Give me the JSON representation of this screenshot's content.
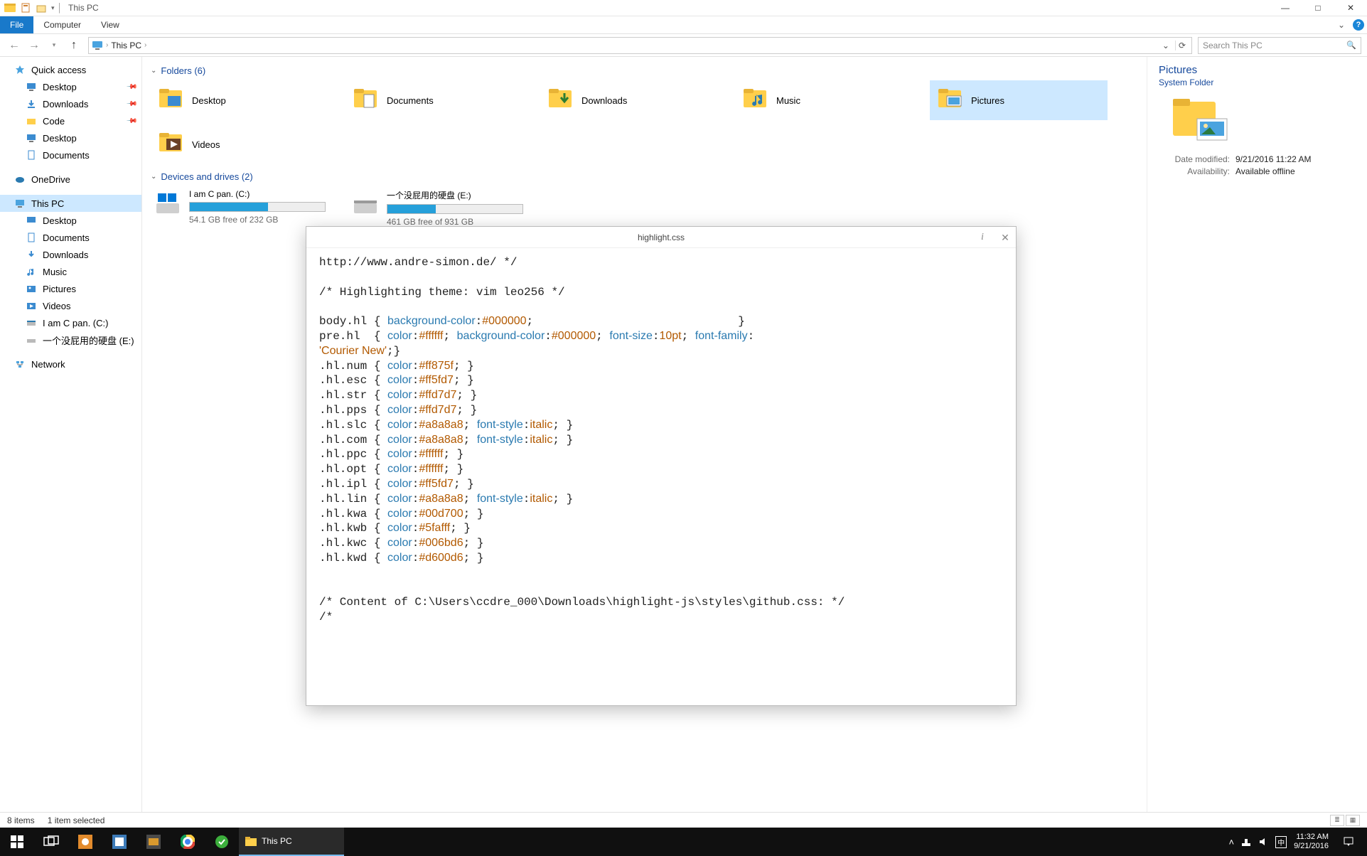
{
  "window": {
    "title": "This PC",
    "qat_dropdown": "▾",
    "win_min": "—",
    "win_max": "□",
    "win_close": "✕"
  },
  "ribbon": {
    "file": "File",
    "computer": "Computer",
    "view": "View",
    "expand": "⌄",
    "help": "?"
  },
  "address": {
    "back": "←",
    "forward": "→",
    "recent_dropdown": "▾",
    "up": "↑",
    "crumb_root": "›",
    "crumb_thispc": "This PC",
    "crumb_chev": "›",
    "dropdown": "⌄",
    "refresh": "⟳",
    "search_placeholder": "Search This PC",
    "search_icon": "🔍"
  },
  "sidebar": {
    "quick_access": "Quick access",
    "quick_items": [
      {
        "label": "Desktop"
      },
      {
        "label": "Downloads"
      },
      {
        "label": "Code"
      },
      {
        "label": "Desktop"
      },
      {
        "label": "Documents"
      }
    ],
    "onedrive": "OneDrive",
    "thispc": "This PC",
    "thispc_items": [
      {
        "label": "Desktop"
      },
      {
        "label": "Documents"
      },
      {
        "label": "Downloads"
      },
      {
        "label": "Music"
      },
      {
        "label": "Pictures"
      },
      {
        "label": "Videos"
      },
      {
        "label": "I am C pan. (C:)"
      },
      {
        "label": "一个没屁用的硬盘 (E:)"
      }
    ],
    "network": "Network"
  },
  "content": {
    "folders_header": "Folders (6)",
    "folders": [
      {
        "label": "Desktop"
      },
      {
        "label": "Documents"
      },
      {
        "label": "Downloads"
      },
      {
        "label": "Music"
      },
      {
        "label": "Pictures",
        "selected": true
      },
      {
        "label": "Videos"
      }
    ],
    "drives_header": "Devices and drives (2)",
    "drives": [
      {
        "label": "I am C pan. (C:)",
        "free_text": "54.1 GB free of 232 GB",
        "fill_pct": 58
      },
      {
        "label": "一个没屁用的硬盘 (E:)",
        "free_text": "461 GB free of 931 GB",
        "fill_pct": 36
      }
    ]
  },
  "details": {
    "title": "Pictures",
    "subtitle": "System Folder",
    "rows": [
      {
        "k": "Date modified:",
        "v": "9/21/2016 11:22 AM"
      },
      {
        "k": "Availability:",
        "v": "Available offline"
      }
    ]
  },
  "preview": {
    "title": "highlight.css",
    "info_icon": "i",
    "close_icon": "✕",
    "lines": [
      {
        "t": "http://www.andre-simon.de/ */"
      },
      {
        "t": ""
      },
      {
        "t": "/* Highlighting theme: vim leo256 */"
      },
      {
        "t": ""
      },
      {
        "sel": "body.hl { ",
        "prop": "background-color",
        "colon": ":",
        "val": "#000000",
        "tail": ";",
        "close_far": "}"
      },
      {
        "sel": "pre.hl  { ",
        "segs": [
          {
            "prop": "color",
            "val": "#ffffff"
          },
          {
            "prop": "background-color",
            "val": "#000000"
          },
          {
            "prop": "font-size",
            "val": "10pt"
          },
          {
            "prop": "font-family",
            "val": null
          }
        ],
        "trailing_colon": ":"
      },
      {
        "sel": "",
        "strv": "'Courier New'",
        "tail2": ";}"
      },
      {
        "sel": ".hl.num { ",
        "prop": "color",
        "val": "#ff875f",
        "tail": "; }"
      },
      {
        "sel": ".hl.esc { ",
        "prop": "color",
        "val": "#ff5fd7",
        "tail": "; }"
      },
      {
        "sel": ".hl.str { ",
        "prop": "color",
        "val": "#ffd7d7",
        "tail": "; }"
      },
      {
        "sel": ".hl.pps { ",
        "prop": "color",
        "val": "#ffd7d7",
        "tail": "; }"
      },
      {
        "sel": ".hl.slc { ",
        "segs": [
          {
            "prop": "color",
            "val": "#a8a8a8"
          },
          {
            "prop": "font-style",
            "val": "italic"
          }
        ],
        "tail": "; }"
      },
      {
        "sel": ".hl.com { ",
        "segs": [
          {
            "prop": "color",
            "val": "#a8a8a8"
          },
          {
            "prop": "font-style",
            "val": "italic"
          }
        ],
        "tail": "; }"
      },
      {
        "sel": ".hl.ppc { ",
        "prop": "color",
        "val": "#ffffff",
        "tail": "; }"
      },
      {
        "sel": ".hl.opt { ",
        "prop": "color",
        "val": "#ffffff",
        "tail": "; }"
      },
      {
        "sel": ".hl.ipl { ",
        "prop": "color",
        "val": "#ff5fd7",
        "tail": "; }"
      },
      {
        "sel": ".hl.lin { ",
        "segs": [
          {
            "prop": "color",
            "val": "#a8a8a8"
          },
          {
            "prop": "font-style",
            "val": "italic"
          }
        ],
        "tail": "; }"
      },
      {
        "sel": ".hl.kwa { ",
        "prop": "color",
        "val": "#00d700",
        "tail": "; }"
      },
      {
        "sel": ".hl.kwb { ",
        "prop": "color",
        "val": "#5fafff",
        "tail": "; }"
      },
      {
        "sel": ".hl.kwc { ",
        "prop": "color",
        "val": "#006bd6",
        "tail": "; }"
      },
      {
        "sel": ".hl.kwd { ",
        "prop": "color",
        "val": "#d600d6",
        "tail": "; }"
      },
      {
        "t": ""
      },
      {
        "t": ""
      },
      {
        "t": "/* Content of C:\\Users\\ccdre_000\\Downloads\\highlight-js\\styles\\github.css: */"
      },
      {
        "t": "/*"
      }
    ]
  },
  "statusbar": {
    "items": "8 items",
    "selected": "1 item selected"
  },
  "taskbar": {
    "this_pc_label": "This PC",
    "time": "11:32 AM",
    "date": "9/21/2016"
  }
}
